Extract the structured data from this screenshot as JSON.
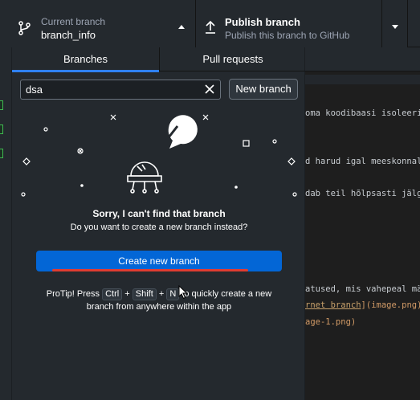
{
  "toolbar": {
    "current_branch_label": "Current branch",
    "current_branch_value": "branch_info",
    "branch_icon": "git-branch-icon",
    "publish_title": "Publish branch",
    "publish_subtitle": "Publish this branch to GitHub",
    "publish_icon": "upload-icon"
  },
  "tabs": [
    {
      "label": "Branches",
      "active": true
    },
    {
      "label": "Pull requests",
      "active": false
    }
  ],
  "search": {
    "value": "dsa",
    "clear_icon": "close-icon"
  },
  "new_branch_label": "New branch",
  "empty_state": {
    "title": "Sorry, I can't find that branch",
    "subtitle": "Do you want to create a new branch instead?"
  },
  "create_button_label": "Create new branch",
  "protip": {
    "prefix": "ProTip! Press",
    "keys": [
      "Ctrl",
      "Shift",
      "N"
    ],
    "plus": "+",
    "suffix_line1": "to quickly create a new",
    "line2": "branch from anywhere within the app"
  },
  "background_code": [
    {
      "text": "oma koodibaasi isoleeri",
      "kind": "plain"
    },
    {
      "text": "d harud igal meeskonnali",
      "kind": "plain"
    },
    {
      "text": "dab teil hõlpsasti jälgi",
      "kind": "plain"
    },
    {
      "text": "atused, mis vahepeal mä",
      "kind": "plain"
    },
    {
      "text_prefix": "",
      "text_link": "rnet branch",
      "text_suffix": "](image.png)",
      "kind": "link"
    },
    {
      "text": "age-1.png)",
      "kind": "link"
    }
  ],
  "colors": {
    "accent": "#0366d6",
    "tab_underline": "#2f81f7",
    "annotation_line": "#e03c31"
  }
}
